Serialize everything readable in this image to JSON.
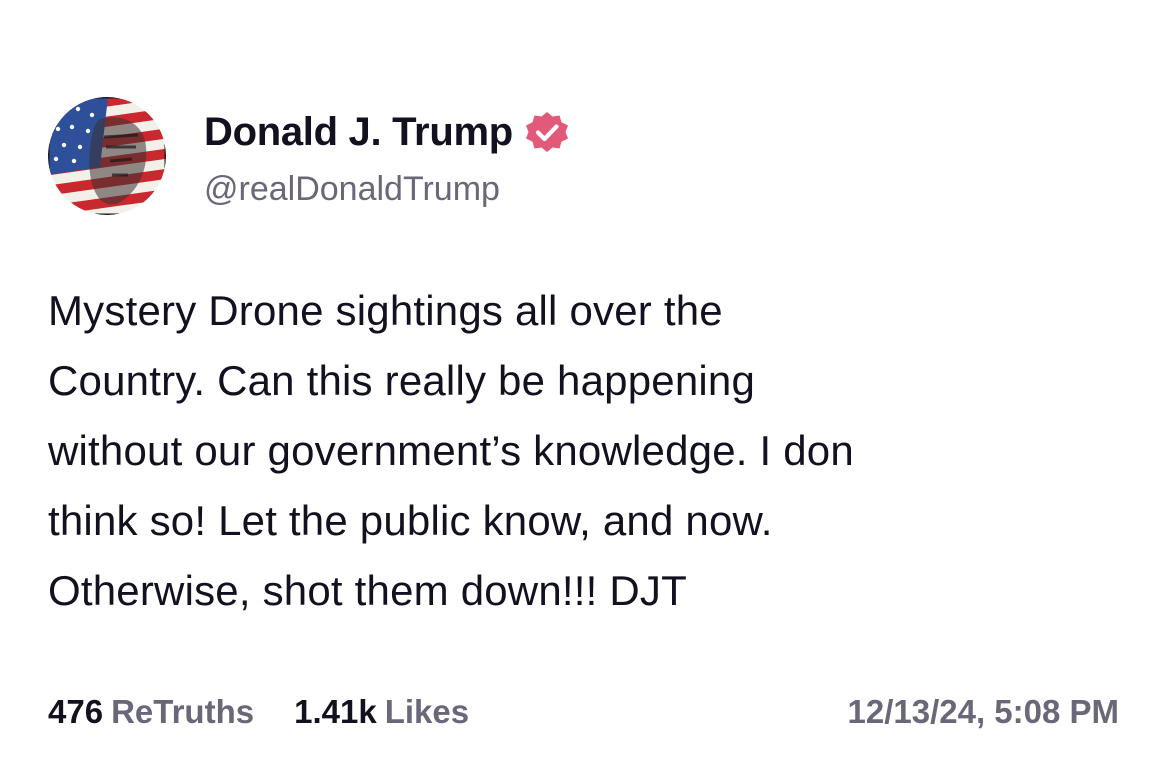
{
  "author": {
    "display_name": "Donald J. Trump",
    "handle": "@realDonaldTrump",
    "avatar": "avatar-image",
    "verified_icon": "verified-badge-icon",
    "verified_color": "#e25a7a"
  },
  "post": {
    "lines": [
      "Mystery Drone sightings all over the",
      "Country. Can this really be happening",
      "without our government’s knowledge. I don",
      "think so! Let the public know, and now.",
      "Otherwise, shot them down!!! DJT"
    ]
  },
  "stats": {
    "retruths_count": "476",
    "retruths_label": "ReTruths",
    "likes_count": "1.41k",
    "likes_label": "Likes",
    "timestamp": "12/13/24, 5:08 PM"
  },
  "colors": {
    "text_primary": "#13111f",
    "text_secondary": "#6b6778",
    "background": "#ffffff"
  }
}
